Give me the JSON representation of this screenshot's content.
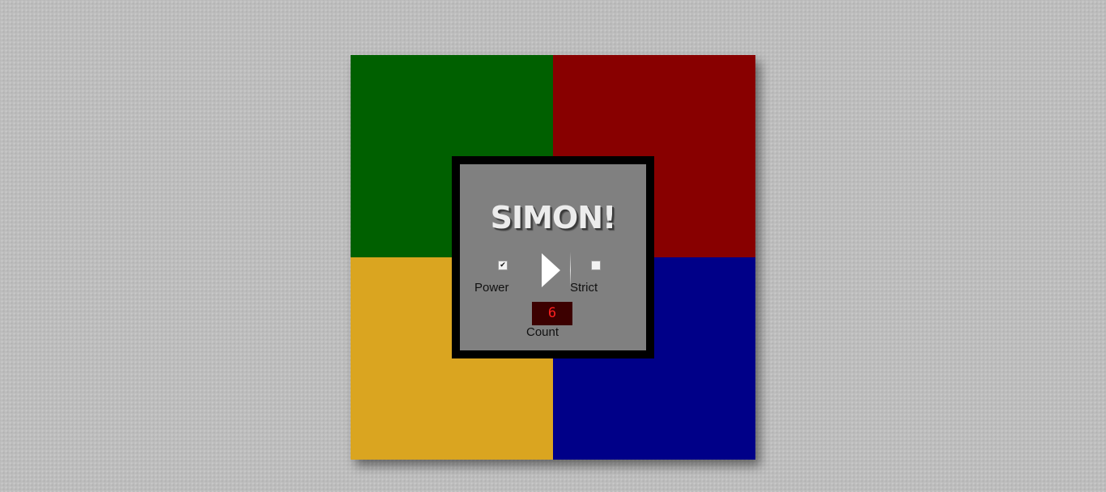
{
  "game": {
    "title": "SIMON!",
    "colors": {
      "green": "#006000",
      "red": "#880000",
      "yellow": "#daa520",
      "blue": "#000088",
      "panel": "#808080",
      "panel_border": "#000000",
      "count_bg": "#3c0000",
      "count_text": "#ff2020"
    },
    "controls": {
      "power": {
        "label": "Power",
        "checked": true
      },
      "strict": {
        "label": "Strict",
        "checked": false
      },
      "start_icon": "play-icon"
    },
    "count": {
      "label": "Count",
      "value": "6"
    }
  }
}
